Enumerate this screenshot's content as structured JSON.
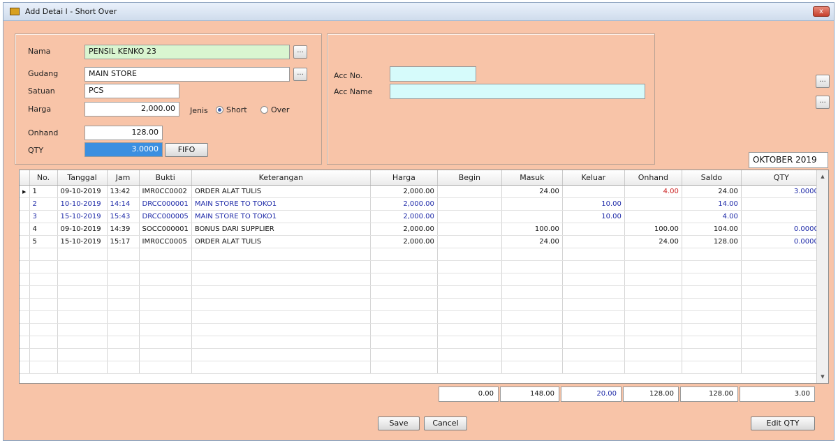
{
  "window": {
    "title": "Add Detai l - Short Over",
    "close": "x"
  },
  "form": {
    "nama": {
      "label": "Nama",
      "value": "PENSIL KENKO 23"
    },
    "gudang": {
      "label": "Gudang",
      "value": "MAIN STORE"
    },
    "satuan": {
      "label": "Satuan",
      "value": "PCS"
    },
    "harga": {
      "label": "Harga",
      "value": "2,000.00"
    },
    "jenis": {
      "label": "Jenis",
      "options": [
        "Short",
        "Over"
      ],
      "selected": "Short"
    },
    "onhand": {
      "label": "Onhand",
      "value": "128.00"
    },
    "qty": {
      "label": "QTY",
      "value": "3.0000"
    },
    "fifo_button": "FIFO",
    "dots": "..."
  },
  "account": {
    "acc_no_label": "Acc No.",
    "acc_no_value": "",
    "acc_name_label": "Acc Name",
    "acc_name_value": ""
  },
  "period": "OKTOBER 2019",
  "table": {
    "columns": [
      "No.",
      "Tanggal",
      "Jam",
      "Bukti",
      "Keterangan",
      "Harga",
      "Begin",
      "Masuk",
      "Keluar",
      "Onhand",
      "Saldo",
      "QTY"
    ],
    "rows": [
      {
        "no": "1",
        "tanggal": "09-10-2019",
        "jam": "13:42",
        "bukti": "IMR0CC0002",
        "keterangan": "ORDER ALAT TULIS",
        "harga": "2,000.00",
        "begin": "",
        "masuk": "24.00",
        "keluar": "",
        "onhand": "4.00",
        "saldo": "24.00",
        "qty": "3.0000"
      },
      {
        "no": "2",
        "tanggal": "10-10-2019",
        "jam": "14:14",
        "bukti": "DRCC000001",
        "keterangan": "MAIN STORE TO TOKO1",
        "harga": "2,000.00",
        "begin": "",
        "masuk": "",
        "keluar": "10.00",
        "onhand": "",
        "saldo": "14.00",
        "qty": ""
      },
      {
        "no": "3",
        "tanggal": "15-10-2019",
        "jam": "15:43",
        "bukti": "DRCC000005",
        "keterangan": "MAIN STORE TO TOKO1",
        "harga": "2,000.00",
        "begin": "",
        "masuk": "",
        "keluar": "10.00",
        "onhand": "",
        "saldo": "4.00",
        "qty": ""
      },
      {
        "no": "4",
        "tanggal": "09-10-2019",
        "jam": "14:39",
        "bukti": "SOCC000001",
        "keterangan": "BONUS DARI SUPPLIER",
        "harga": "2,000.00",
        "begin": "",
        "masuk": "100.00",
        "keluar": "",
        "onhand": "100.00",
        "saldo": "104.00",
        "qty": "0.0000"
      },
      {
        "no": "5",
        "tanggal": "15-10-2019",
        "jam": "15:17",
        "bukti": "IMR0CC0005",
        "keterangan": "ORDER ALAT TULIS",
        "harga": "2,000.00",
        "begin": "",
        "masuk": "24.00",
        "keluar": "",
        "onhand": "24.00",
        "saldo": "128.00",
        "qty": "0.0000"
      }
    ]
  },
  "totals": {
    "begin": "0.00",
    "masuk": "148.00",
    "keluar": "20.00",
    "onhand": "128.00",
    "saldo": "128.00",
    "qty": "3.00"
  },
  "buttons": {
    "save": "Save",
    "cancel": "Cancel",
    "edit_qty": "Edit QTY"
  },
  "colors": {
    "background": "#f8c4a8",
    "name_field": "#d9f5d0",
    "qty_highlight": "#3b8fe0",
    "acc_field": "#d6fbfb",
    "transfer_text": "#1e2aa8",
    "warning_text": "#c22222"
  }
}
